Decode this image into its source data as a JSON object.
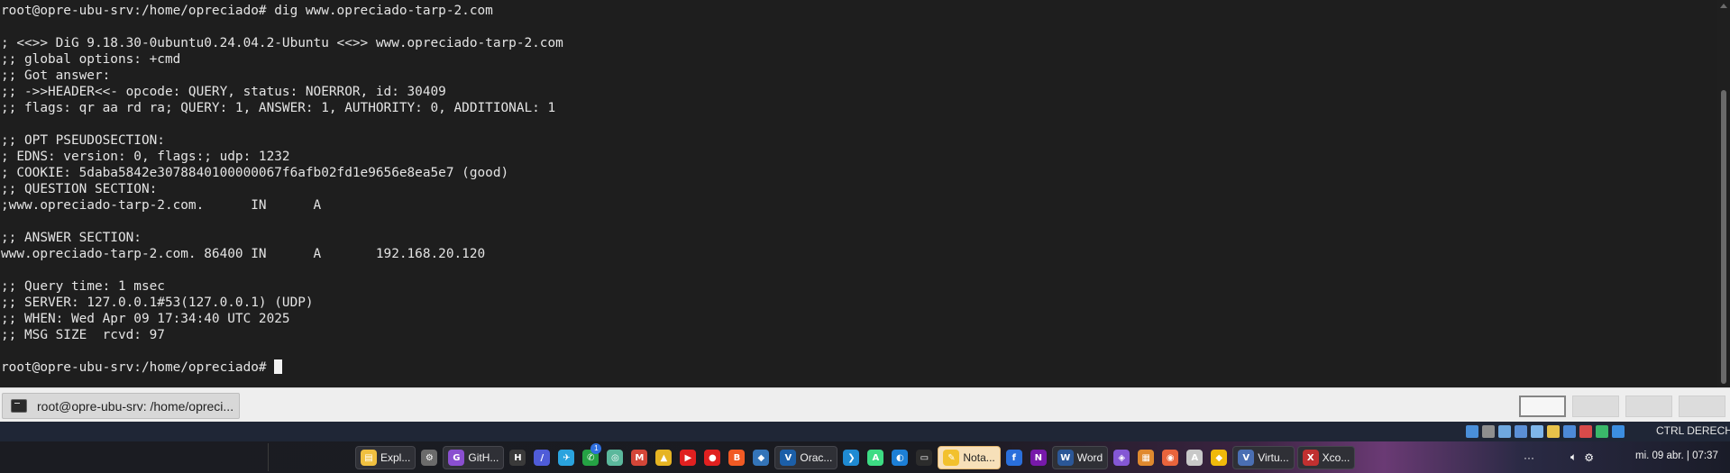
{
  "terminal": {
    "lines": [
      "root@opre-ubu-srv:/home/opreciado# dig www.opreciado-tarp-2.com",
      "",
      "; <<>> DiG 9.18.30-0ubuntu0.24.04.2-Ubuntu <<>> www.opreciado-tarp-2.com",
      ";; global options: +cmd",
      ";; Got answer:",
      ";; ->>HEADER<<- opcode: QUERY, status: NOERROR, id: 30409",
      ";; flags: qr aa rd ra; QUERY: 1, ANSWER: 1, AUTHORITY: 0, ADDITIONAL: 1",
      "",
      ";; OPT PSEUDOSECTION:",
      "; EDNS: version: 0, flags:; udp: 1232",
      "; COOKIE: 5daba5842e3078840100000067f6afb02fd1e9656e8ea5e7 (good)",
      ";; QUESTION SECTION:",
      ";www.opreciado-tarp-2.com.      IN      A",
      "",
      ";; ANSWER SECTION:",
      "www.opreciado-tarp-2.com. 86400 IN      A       192.168.20.120",
      "",
      ";; Query time: 1 msec",
      ";; SERVER: 127.0.0.1#53(127.0.0.1) (UDP)",
      ";; WHEN: Wed Apr 09 17:34:40 UTC 2025",
      ";; MSG SIZE  rcvd: 97",
      ""
    ],
    "prompt": "root@opre-ubu-srv:/home/opreciado# "
  },
  "window_taskbar": {
    "task_label": "root@opre-ubu-srv: /home/opreci...",
    "workspaces": 4,
    "active_workspace": 1
  },
  "vbox_status": {
    "host_key": "CTRL DERECHA",
    "icons": [
      "hdd-icon",
      "optical-icon",
      "audio-icon",
      "network-icon",
      "usb-icon",
      "shared-folders-icon",
      "display-icon",
      "recording-icon",
      "vt-x-icon",
      "mouse-icon"
    ]
  },
  "win_taskbar": {
    "apps": [
      {
        "name": "file-explorer",
        "label": "Expl...",
        "color": "#f0c040",
        "glyph": "▤"
      },
      {
        "name": "settings",
        "label": "",
        "color": "#6b6b6b",
        "glyph": "⚙"
      },
      {
        "name": "github",
        "label": "GitH...",
        "color": "#8a4fd0",
        "glyph": "G"
      },
      {
        "name": "app-h",
        "label": "",
        "color": "#3a3a3a",
        "glyph": "H"
      },
      {
        "name": "app-slash",
        "label": "",
        "color": "#4f5cd8",
        "glyph": "/"
      },
      {
        "name": "telegram",
        "label": "",
        "color": "#2aa3de",
        "glyph": "✈"
      },
      {
        "name": "whatsapp",
        "label": "",
        "color": "#25a244",
        "glyph": "✆",
        "badge": "1"
      },
      {
        "name": "chatgpt",
        "label": "",
        "color": "#5bb89c",
        "glyph": "◎"
      },
      {
        "name": "gmail",
        "label": "",
        "color": "#d44638",
        "glyph": "M"
      },
      {
        "name": "google-drive",
        "label": "",
        "color": "#e6b422",
        "glyph": "▲"
      },
      {
        "name": "youtube",
        "label": "",
        "color": "#e02020",
        "glyph": "▶"
      },
      {
        "name": "youtube-music",
        "label": "",
        "color": "#e02020",
        "glyph": "●"
      },
      {
        "name": "brave",
        "label": "",
        "color": "#f15a24",
        "glyph": "B"
      },
      {
        "name": "virtualbox",
        "label": "",
        "color": "#3474b8",
        "glyph": "◆"
      },
      {
        "name": "oracle-virtualbox",
        "label": "Orac...",
        "color": "#1c5fa8",
        "glyph": "V"
      },
      {
        "name": "vscode",
        "label": "",
        "color": "#1f8ad2",
        "glyph": "❯"
      },
      {
        "name": "android-studio",
        "label": "",
        "color": "#3ddc84",
        "glyph": "A"
      },
      {
        "name": "app-blue",
        "label": "",
        "color": "#1c7fd6",
        "glyph": "◐"
      },
      {
        "name": "terminal",
        "label": "",
        "color": "#2c2c2c",
        "glyph": "▭"
      },
      {
        "name": "notas",
        "label": "Nota...",
        "color": "#f2c12e",
        "glyph": "✎",
        "highlight": true
      },
      {
        "name": "app-f",
        "label": "",
        "color": "#2a6fdb",
        "glyph": "f"
      },
      {
        "name": "onenote",
        "label": "",
        "color": "#7719aa",
        "glyph": "N"
      },
      {
        "name": "word",
        "label": "Word",
        "color": "#2b5797",
        "glyph": "W"
      },
      {
        "name": "app-drop",
        "label": "",
        "color": "#8457d4",
        "glyph": "◈"
      },
      {
        "name": "app-orange",
        "label": "",
        "color": "#e0892e",
        "glyph": "▦"
      },
      {
        "name": "app-eclipse",
        "label": "",
        "color": "#e8643c",
        "glyph": "◉"
      },
      {
        "name": "app-lang",
        "label": "",
        "color": "#c8c8c8",
        "glyph": "A"
      },
      {
        "name": "binance",
        "label": "",
        "color": "#f0b90b",
        "glyph": "◆"
      },
      {
        "name": "virtualbox-vm",
        "label": "Virtu...",
        "color": "#4a6fb3",
        "glyph": "V"
      },
      {
        "name": "xcode-app",
        "label": "Xco...",
        "color": "#c03030",
        "glyph": "X"
      }
    ],
    "tray_more": "···",
    "clock": "mi. 09 abr. | 07:37"
  }
}
